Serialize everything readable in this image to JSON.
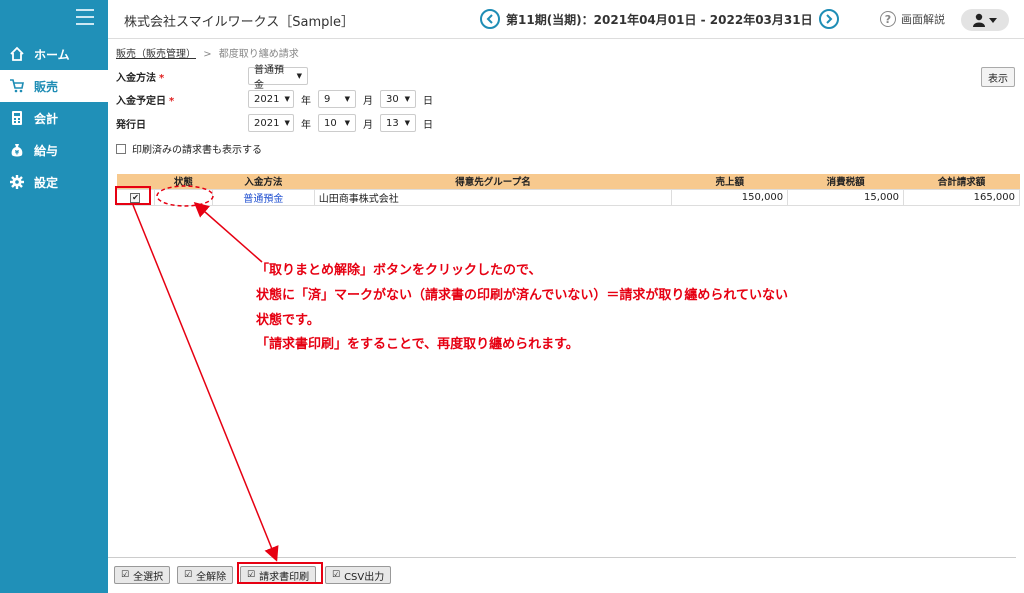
{
  "app": {
    "company": "株式会社スマイルワークス［Sample］"
  },
  "header": {
    "period_text": "第11期(当期)：2021年04月01日 - 2022年03月31日",
    "help_label": "画面解説"
  },
  "sidebar": {
    "items": [
      {
        "label": "ホーム",
        "icon": "home-icon"
      },
      {
        "label": "販売",
        "icon": "cart-icon",
        "active": true
      },
      {
        "label": "会計",
        "icon": "calculator-icon"
      },
      {
        "label": "給与",
        "icon": "money-bag-icon"
      },
      {
        "label": "設定",
        "icon": "gear-icon"
      }
    ]
  },
  "breadcrumb": {
    "parent": "販売（販売管理）",
    "separator": ">",
    "current": "都度取り纏め請求"
  },
  "form": {
    "payment_label": "入金方法",
    "payment_value": "普通預金",
    "due_label": "入金予定日",
    "due_year": "2021",
    "due_month": "9",
    "due_day": "30",
    "issue_label": "発行日",
    "issue_year": "2021",
    "issue_month": "10",
    "issue_day": "13",
    "unit_year": "年",
    "unit_month": "月",
    "unit_day": "日",
    "required_mark": "*",
    "show_printed_label": "印刷済みの請求書も表示する",
    "show_button": "表示"
  },
  "table": {
    "headers": [
      "状態",
      "入金方法",
      "得意先グループ名",
      "売上額",
      "消費税額",
      "合計請求額"
    ],
    "rows": [
      {
        "checked": true,
        "status": "",
        "payment": "普通預金",
        "group": "山田商事株式会社",
        "sales": "150,000",
        "tax": "15,000",
        "total": "165,000"
      }
    ]
  },
  "annotation": {
    "line1": "「取りまとめ解除」ボタンをクリックしたので、",
    "line2": "状態に「済」マークがない（請求書の印刷が済んでいない）＝請求が取り纏められていない",
    "line3": "状態です。",
    "line4": "「請求書印刷」をすることで、再度取り纏められます。",
    "color": "#e60012"
  },
  "toolbar": {
    "select_all": "全選択",
    "deselect_all": "全解除",
    "print_invoice": "請求書印刷",
    "csv_export": "CSV出力"
  },
  "colors": {
    "sidebar": "#2090b8",
    "table_header": "#f7c98e",
    "accent": "#1f8db5"
  }
}
